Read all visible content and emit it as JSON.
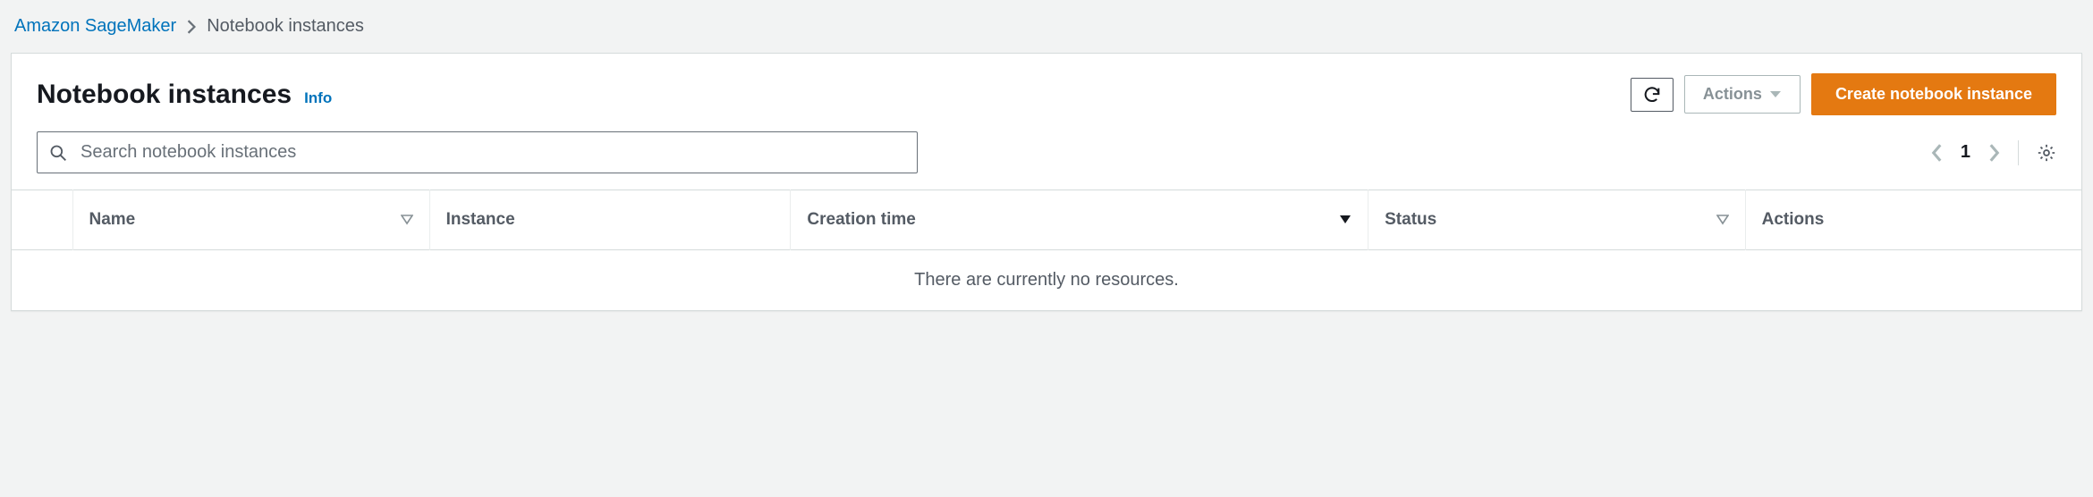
{
  "breadcrumb": {
    "parent": "Amazon SageMaker",
    "current": "Notebook instances"
  },
  "panel": {
    "title": "Notebook instances",
    "info_label": "Info"
  },
  "actions": {
    "actions_label": "Actions",
    "create_label": "Create notebook instance"
  },
  "search": {
    "placeholder": "Search notebook instances"
  },
  "pagination": {
    "current_page": "1"
  },
  "table": {
    "columns": {
      "name": "Name",
      "instance": "Instance",
      "creation_time": "Creation time",
      "status": "Status",
      "actions": "Actions"
    },
    "empty_message": "There are currently no resources."
  }
}
